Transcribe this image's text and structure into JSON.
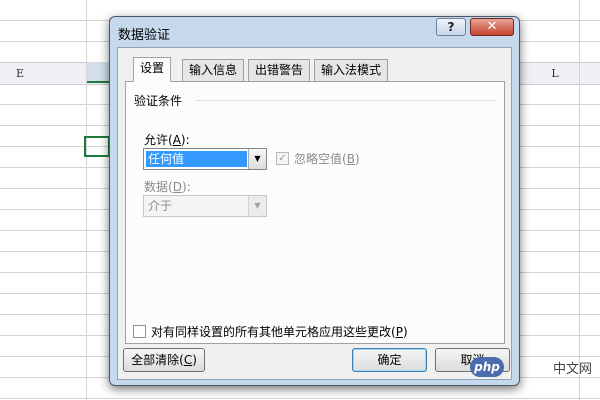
{
  "sheet": {
    "columns": [
      {
        "name": "col-header-e",
        "label": "E"
      },
      {
        "name": "col-header-l",
        "label": "L"
      }
    ],
    "accent": "#1f7a3d"
  },
  "dialog": {
    "title": "数据验证",
    "help_label": "?",
    "close_label": "✕",
    "tabs": [
      "设置",
      "输入信息",
      "出错警告",
      "输入法模式"
    ],
    "active_tab": "设置",
    "group_label": "验证条件",
    "allow": {
      "label_text": "允许",
      "label_key": "A",
      "value": "任何值"
    },
    "ignore_blank": {
      "label_text": "忽略空值",
      "label_key": "B",
      "checked": true,
      "disabled": true
    },
    "data": {
      "label_text": "数据",
      "label_key": "D",
      "value": "介于",
      "disabled": true
    },
    "apply_all": {
      "label_text": "对有同样设置的所有其他单元格应用这些更改",
      "label_key": "P",
      "checked": false
    },
    "buttons": {
      "clear_text": "全部清除",
      "clear_key": "C",
      "ok_label": "确定",
      "cancel_label": "取消"
    },
    "colors": {
      "frame": "#c5d8ec",
      "selection": "#3399ff",
      "close": "#c6452f"
    }
  },
  "watermark": {
    "badge": "php",
    "text": "中文网"
  }
}
